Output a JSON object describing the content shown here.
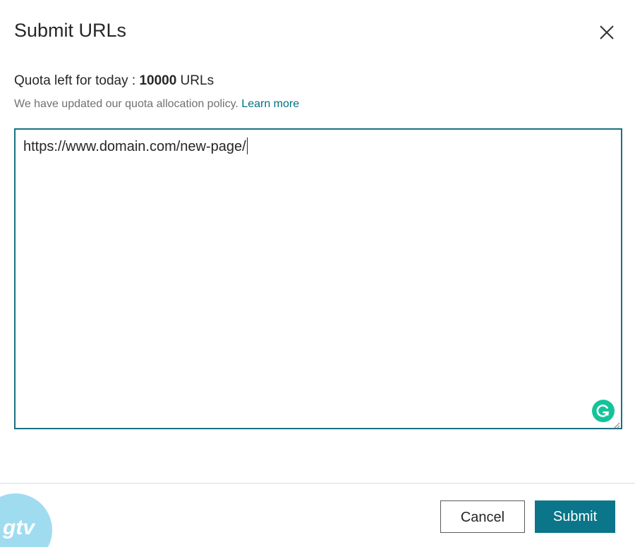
{
  "dialog": {
    "title": "Submit URLs",
    "quota_prefix": "Quota left for today : ",
    "quota_value": "10000",
    "quota_suffix": " URLs",
    "policy_text": "We have updated our quota allocation policy. ",
    "learn_more": "Learn more",
    "url_value": "https://www.domain.com/new-page/"
  },
  "footer": {
    "cancel_label": "Cancel",
    "submit_label": "Submit"
  },
  "watermark": {
    "logo_text": "gtv"
  },
  "icons": {
    "close": "close-icon",
    "grammarly": "grammarly-icon",
    "resize": "resize-handle-icon"
  },
  "colors": {
    "accent": "#0b7589",
    "border": "#1a7082",
    "link": "#006f85",
    "grammarly": "#15c39a",
    "logo": "#9fdcf0"
  }
}
